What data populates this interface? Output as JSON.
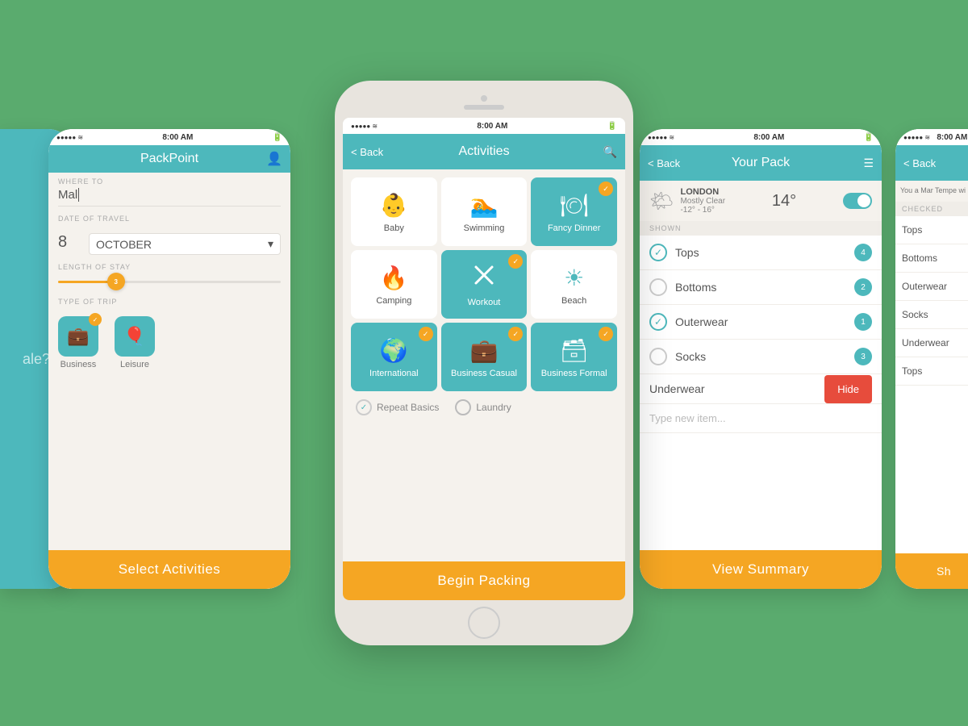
{
  "bg": "#5aab6e",
  "screens": {
    "screen1": {
      "status": {
        "signal": "●●●●●",
        "wifi": "WiFi",
        "time": "8:00 AM",
        "battery": "■"
      },
      "header": {
        "title": "PackPoint",
        "user_icon": "👤"
      },
      "where_to_label": "WHERE TO",
      "where_to_value": "Mal",
      "date_label": "DATE OF TRAVEL",
      "date_day": "8",
      "date_month": "OCTOBER",
      "stay_label": "LENGTH OF STAY",
      "stay_value": "3",
      "trip_label": "TYPE OF TRIP",
      "trip_options": [
        {
          "label": "Business",
          "icon": "💼",
          "selected": true
        },
        {
          "label": "Leisure",
          "icon": "🎈",
          "selected": false
        }
      ],
      "cta_label": "Select Activities"
    },
    "screen2": {
      "status": {
        "signal": "●●●●●",
        "wifi": "WiFi",
        "time": "8:00 AM",
        "battery": "■"
      },
      "header": {
        "back": "< Back",
        "title": "Activities",
        "search_icon": "🔍"
      },
      "activities": [
        {
          "label": "Baby",
          "icon": "👶",
          "selected": false
        },
        {
          "label": "Swimming",
          "icon": "🏊",
          "selected": false
        },
        {
          "label": "Fancy Dinner",
          "icon": "🍽",
          "selected": true
        },
        {
          "label": "Camping",
          "icon": "🔥",
          "selected": false
        },
        {
          "label": "Workout",
          "icon": "⚡",
          "selected": true
        },
        {
          "label": "Beach",
          "icon": "☀",
          "selected": false
        },
        {
          "label": "International",
          "icon": "🌍",
          "selected": true
        },
        {
          "label": "Business Casual",
          "icon": "💼",
          "selected": true
        },
        {
          "label": "Business Formal",
          "icon": "🗃",
          "selected": true
        }
      ],
      "repeat_basics_label": "Repeat Basics",
      "laundry_label": "Laundry",
      "cta_label": "Begin Packing"
    },
    "screen3": {
      "status": {
        "signal": "●●●●●",
        "wifi": "WiFi",
        "time": "8:00 AM",
        "battery": "■"
      },
      "header": {
        "back": "< Back",
        "title": "Your Pack",
        "menu_icon": "☰"
      },
      "weather": {
        "icon": "🌤",
        "city": "LONDON",
        "condition": "Mostly Clear",
        "temp": "14°",
        "range": "-12° - 16°"
      },
      "shown_label": "SHOWN",
      "pack_items": [
        {
          "name": "Tops",
          "count": 4,
          "checked": true
        },
        {
          "name": "Bottoms",
          "count": 2,
          "checked": false
        },
        {
          "name": "Outerwear",
          "count": 1,
          "checked": true
        },
        {
          "name": "Socks",
          "count": 3,
          "checked": false
        }
      ],
      "hide_item": {
        "name": "Underwear",
        "btn": "Hide"
      },
      "new_item_placeholder": "Type new item...",
      "cta_label": "View Summary"
    },
    "screen4": {
      "status": {
        "signal": "●●●●●",
        "wifi": "WiFi",
        "time": "8:00 AM",
        "battery": "■"
      },
      "header": {
        "back": "< Back",
        "partial_text": "You a Mar Tempe wi"
      },
      "checked_label": "CHECKED",
      "items": [
        "Tops",
        "Bottoms",
        "Outerwear",
        "Socks",
        "Underwear",
        "Tops"
      ],
      "cta_label": "Sh"
    },
    "screen5": {
      "partial_text": "ale?"
    }
  }
}
